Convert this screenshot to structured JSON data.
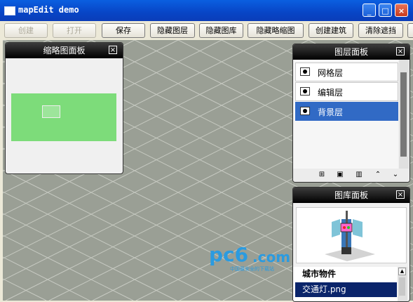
{
  "window": {
    "title": "mapEdit demo",
    "minimize_label": "_",
    "maximize_label": "□",
    "close_label": "×"
  },
  "toolbar": {
    "buttons": [
      {
        "label": "创建",
        "enabled": false
      },
      {
        "label": "打开",
        "enabled": false
      },
      {
        "label": "保存",
        "enabled": true
      },
      {
        "label": "隐藏图层",
        "enabled": true
      },
      {
        "label": "隐藏图库",
        "enabled": true
      },
      {
        "label": "隐藏略缩图",
        "enabled": true
      },
      {
        "label": "创建建筑",
        "enabled": true
      },
      {
        "label": "清除遮挡",
        "enabled": true
      }
    ]
  },
  "thumbnail_panel": {
    "title": "缩略图面板",
    "close_label": "×",
    "map_color": "#7ddc7a"
  },
  "layer_panel": {
    "title": "图层面板",
    "close_label": "×",
    "layers": [
      {
        "label": "网格层",
        "icon": "eye-icon",
        "selected": false
      },
      {
        "label": "编辑层",
        "icon": "eye-icon",
        "selected": false
      },
      {
        "label": "背景层",
        "icon": "eye-icon",
        "selected": true
      }
    ],
    "tools": [
      "new-layer-icon",
      "copy-layer-icon",
      "delete-layer-icon",
      "move-up-icon",
      "move-down-icon"
    ]
  },
  "library_panel": {
    "title": "图库面板",
    "close_label": "×",
    "category": "城市物件",
    "items": [
      {
        "label": "交通灯.png",
        "selected": true
      }
    ]
  },
  "watermark": {
    "brand": "pc6",
    "suffix": ".com",
    "tagline": "中国最安全的下载站"
  },
  "colors": {
    "canvas": "#9a9f95",
    "grid_line": "#c9ccc4",
    "selection": "#316ac5",
    "titlebar": "#0a5fe0"
  }
}
